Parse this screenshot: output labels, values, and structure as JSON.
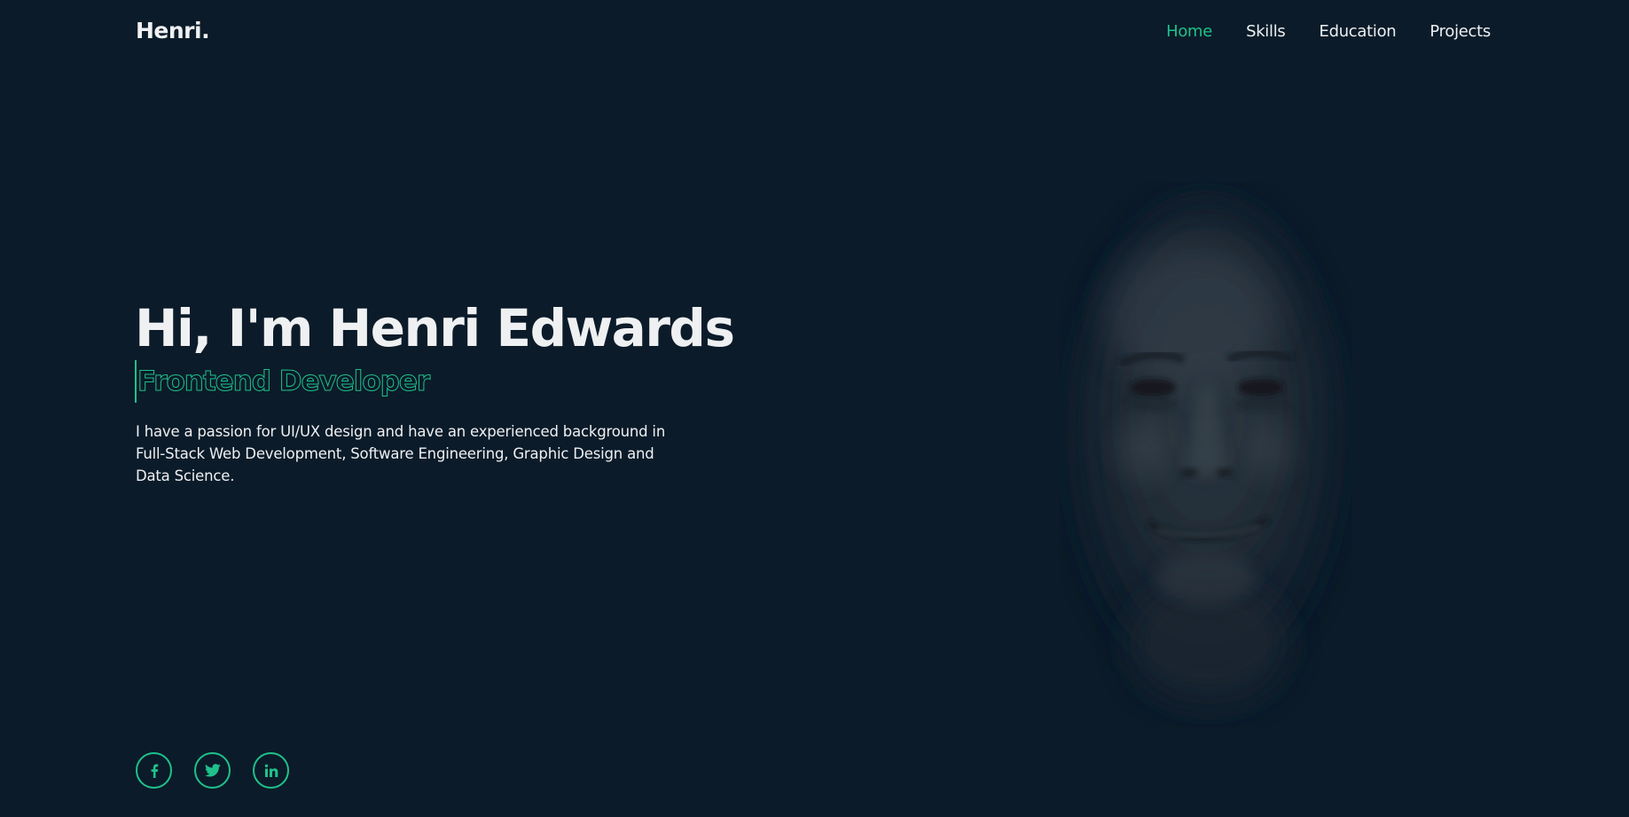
{
  "header": {
    "logo": "Henri.",
    "nav": [
      {
        "label": "Home",
        "active": true
      },
      {
        "label": "Skills",
        "active": false
      },
      {
        "label": "Education",
        "active": false
      },
      {
        "label": "Projects",
        "active": false
      }
    ]
  },
  "hero": {
    "title": "Hi, I'm Henri Edwards",
    "role": "Frontend Developer",
    "intro": "I have a passion for UI/UX design and have an experienced background in Full-Stack Web Development, Software Engineering, Graphic Design and Data Science."
  },
  "socials": [
    {
      "icon": "facebook-icon"
    },
    {
      "icon": "twitter-icon"
    },
    {
      "icon": "linkedin-icon"
    }
  ],
  "colors": {
    "background": "#0b1b29",
    "accent": "#1fc18a",
    "text": "#eef0f2"
  }
}
